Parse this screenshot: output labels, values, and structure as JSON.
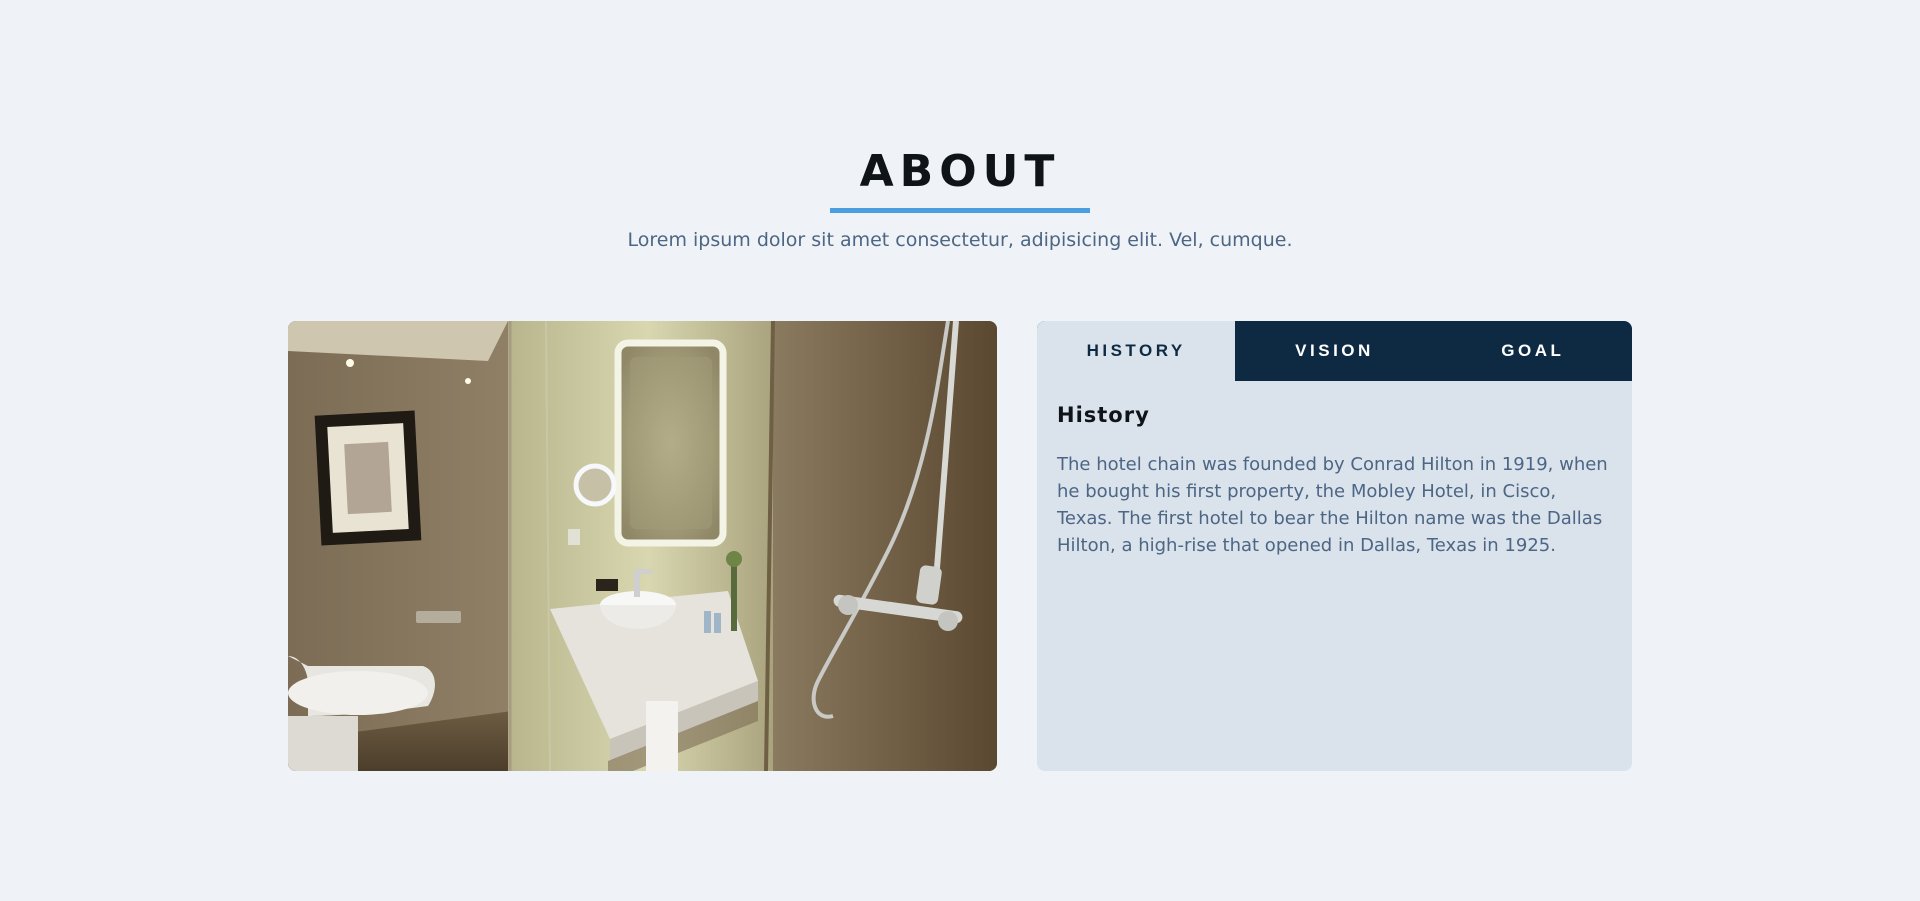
{
  "about": {
    "title": "ABOUT",
    "subtitle": "Lorem ipsum dolor sit amet consectetur, adipisicing elit. Vel, cumque."
  },
  "colors": {
    "background": "#eff3f7",
    "accent": "#4a9fe0",
    "tab_dark": "#0e2a43",
    "panel_bg": "#dae2ec",
    "text_muted": "#4c6684"
  },
  "tabs": [
    {
      "label": "HISTORY",
      "active": true
    },
    {
      "label": "VISION",
      "active": false
    },
    {
      "label": "GOAL",
      "active": false
    }
  ],
  "content": {
    "title": "History",
    "text": "The hotel chain was founded by Conrad Hilton in 1919, when he bought his first property, the Mobley Hotel, in Cisco, Texas. The first hotel to bear the Hilton name was the Dallas Hilton, a high-rise that opened in Dallas, Texas in 1925."
  },
  "image": {
    "icon": "hotel-bathroom-photo"
  }
}
